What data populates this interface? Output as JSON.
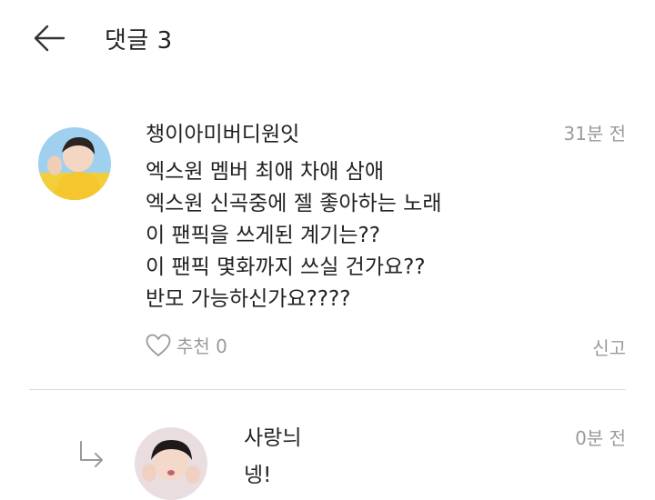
{
  "header": {
    "title": "댓글 3",
    "back_icon": "arrow-left-icon"
  },
  "comments": [
    {
      "author": "챙이아미버디원잇",
      "time": "31분 전",
      "lines": [
        "엑스원 멤버 최애 차애 삼애",
        "엑스원 신곡중에 젤 좋아하는 노래",
        "이 팬픽을 쓰게된 계기는??",
        "이 팬픽 몇화까지 쓰실 건가요??",
        "반모 가능하신가요????"
      ],
      "like_label": "추천 0",
      "report_label": "신고"
    }
  ],
  "replies": [
    {
      "author": "사랑늬",
      "time": "0분 전",
      "text": "넹!"
    }
  ],
  "colors": {
    "text": "#222222",
    "muted": "#9a9a9a",
    "divider": "#dcdcdc"
  }
}
